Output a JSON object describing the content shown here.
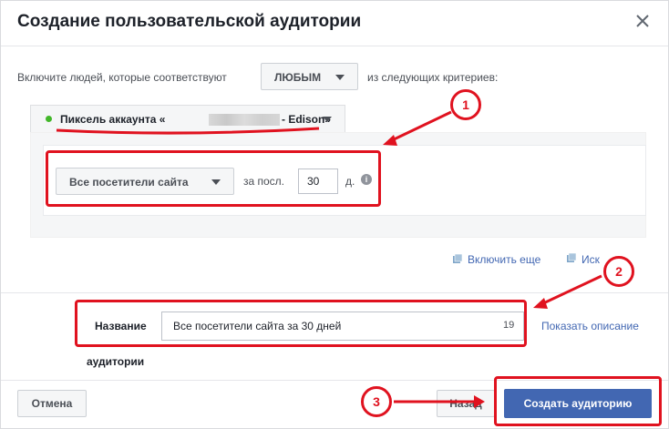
{
  "dialog": {
    "title": "Создание пользовательской аудитории",
    "close_icon": "close-icon"
  },
  "criteria": {
    "intro_before": "Включите людей, которые соответствуют",
    "match_value": "ЛЮБЫМ",
    "intro_after": "из следующих критериев:"
  },
  "pixel": {
    "label_prefix": "Пиксель аккаунта «",
    "label_suffix": "- Edison»",
    "status_color": "#42b72a"
  },
  "rule": {
    "event": "Все посетители сайта",
    "period_label": "за посл.",
    "days": "30",
    "days_unit": "д.",
    "info_icon": "info-icon"
  },
  "links": {
    "include_more": "Включить еще",
    "exclude": "Иск"
  },
  "audience_name": {
    "label_line1": "Название",
    "label_line2": "аудитории",
    "value": "Все посетители сайта за 30 дней",
    "char_count": "19",
    "show_description": "Показать описание"
  },
  "footer": {
    "cancel": "Отмена",
    "back": "Назад",
    "create": "Создать аудиторию"
  },
  "annotations": {
    "badge_1": "1",
    "badge_2": "2",
    "badge_3": "3",
    "color": "#e0121f"
  },
  "colors": {
    "accent": "#4267b2",
    "highlight": "#e0121f"
  }
}
